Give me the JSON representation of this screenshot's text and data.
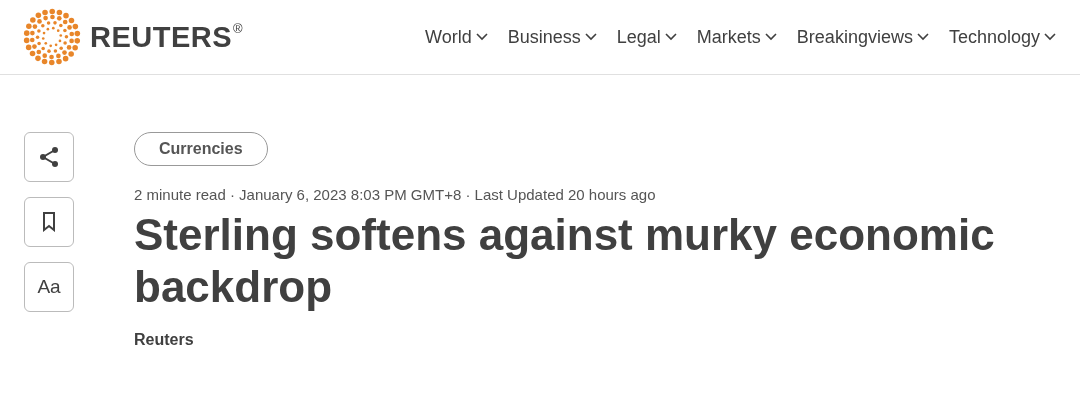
{
  "header": {
    "logo": {
      "wordmark": "REUTERS",
      "mark": "®"
    },
    "nav": [
      {
        "label": "World"
      },
      {
        "label": "Business"
      },
      {
        "label": "Legal"
      },
      {
        "label": "Markets"
      },
      {
        "label": "Breakingviews"
      },
      {
        "label": "Technology"
      }
    ]
  },
  "tools": [
    {
      "kind": "share"
    },
    {
      "kind": "bookmark"
    },
    {
      "kind": "text",
      "label": "Aa"
    }
  ],
  "article": {
    "tag": "Currencies",
    "meta": "2 minute read · January 6, 2023 8:03 PM GMT+8 · Last Updated 20 hours ago",
    "headline": "Sterling softens against murky economic backdrop",
    "byline": "Reuters"
  }
}
